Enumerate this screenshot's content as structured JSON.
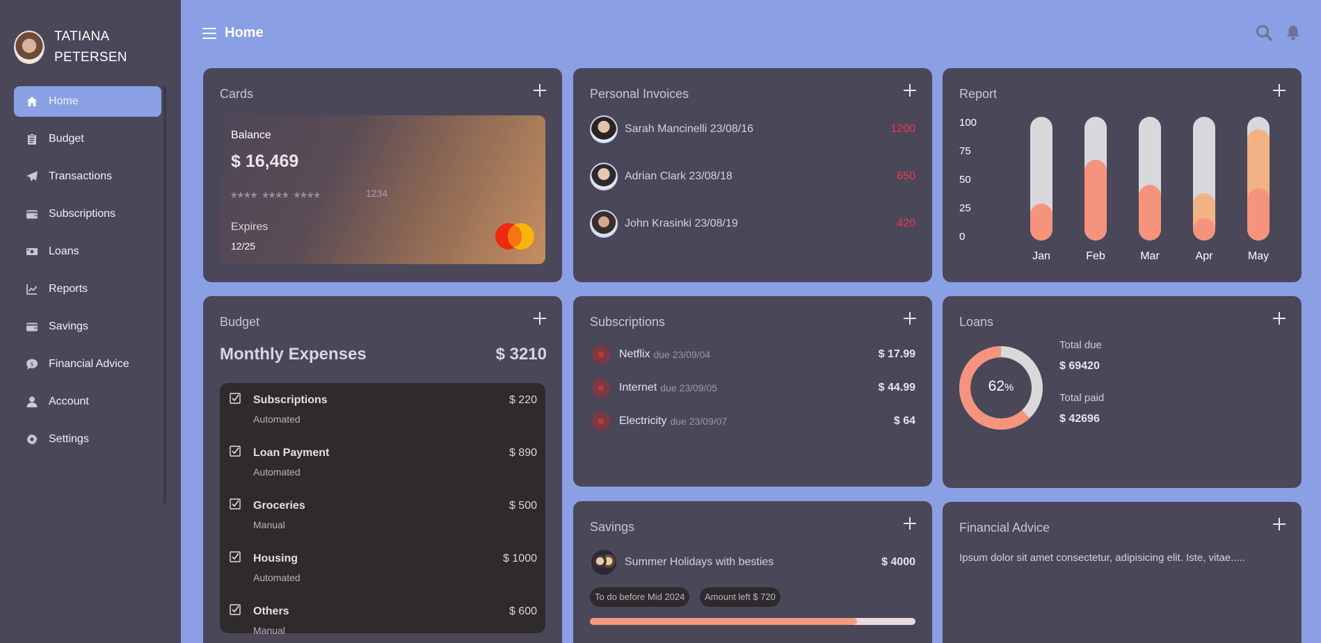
{
  "user": {
    "name": "TATIANA PETERSEN"
  },
  "nav": [
    {
      "label": "Home",
      "icon": "home-icon",
      "active": true
    },
    {
      "label": "Budget",
      "icon": "clipboard-icon"
    },
    {
      "label": "Transactions",
      "icon": "paper-plane-icon"
    },
    {
      "label": "Subscriptions",
      "icon": "wallet-icon"
    },
    {
      "label": "Loans",
      "icon": "money-icon"
    },
    {
      "label": "Reports",
      "icon": "chart-line-icon"
    },
    {
      "label": "Savings",
      "icon": "wallet-icon"
    },
    {
      "label": "Financial Advice",
      "icon": "comment-dollar-icon"
    },
    {
      "label": "Account",
      "icon": "user-icon"
    },
    {
      "label": "Settings",
      "icon": "gear-icon"
    }
  ],
  "header": {
    "title": "Home"
  },
  "cards": {
    "title": "Cards",
    "balance_label": "Balance",
    "balance": "$ 16,469",
    "masked": "**** **** ****",
    "last4": "1234",
    "expires_label": "Expires",
    "expires": "12/25"
  },
  "invoices": {
    "title": "Personal Invoices",
    "rows": [
      {
        "name": "Sarah Mancinelli 23/08/16",
        "amount": "1200"
      },
      {
        "name": "Adrian Clark 23/08/18",
        "amount": "650"
      },
      {
        "name": "John Krasinki 23/08/19",
        "amount": "420"
      }
    ]
  },
  "report": {
    "title": "Report",
    "chart_data": {
      "type": "bar",
      "categories": [
        "Jan",
        "Feb",
        "Mar",
        "Apr",
        "May"
      ],
      "series": [
        {
          "values": [
            30,
            65,
            45,
            18,
            42
          ],
          "color": "#f5937d"
        },
        {
          "values": [
            0,
            0,
            0,
            20,
            48
          ],
          "color": "#f2b283"
        }
      ],
      "yticks": [
        "100",
        "75",
        "50",
        "25",
        "0"
      ],
      "ylim": [
        0,
        100
      ]
    }
  },
  "budget": {
    "title": "Budget",
    "heading": "Monthly Expenses",
    "total": "$ 3210",
    "items": [
      {
        "name": "Subscriptions",
        "type": "Automated",
        "amount": "$ 220"
      },
      {
        "name": "Loan Payment",
        "type": "Automated",
        "amount": "$ 890"
      },
      {
        "name": "Groceries",
        "type": "Manual",
        "amount": "$ 500"
      },
      {
        "name": "Housing",
        "type": "Automated",
        "amount": "$ 1000"
      },
      {
        "name": "Others",
        "type": "Manual",
        "amount": "$ 600"
      }
    ]
  },
  "subscriptions": {
    "title": "Subscriptions",
    "rows": [
      {
        "name": "Netflix",
        "due": "due 23/09/04",
        "amount": "$ 17.99"
      },
      {
        "name": "Internet",
        "due": "due 23/09/05",
        "amount": "$ 44.99"
      },
      {
        "name": "Electricity",
        "due": "due 23/09/07",
        "amount": "$ 64"
      }
    ]
  },
  "loans": {
    "title": "Loans",
    "percent": "62",
    "percent_sign": "%",
    "progress": 0.62,
    "total_due_label": "Total due",
    "total_due": "$ 69420",
    "total_paid_label": "Total paid",
    "total_paid": "$ 42696"
  },
  "savings": {
    "title": "Savings",
    "goal": "Summer Holidays with besties",
    "amount": "$ 4000",
    "chip_deadline": "To do before Mid 2024",
    "chip_left": "Amount left $ 720",
    "progress": 0.82
  },
  "advice": {
    "title": "Financial Advice",
    "text": "Ipsum dolor sit amet consectetur, adipisicing elit. Iste, vitae....."
  },
  "colors": {
    "accent": "#8a9fe4",
    "panel": "#4a4759",
    "bar": "#f5937d",
    "bar2": "#f2b283",
    "negative": "#f0384a"
  }
}
